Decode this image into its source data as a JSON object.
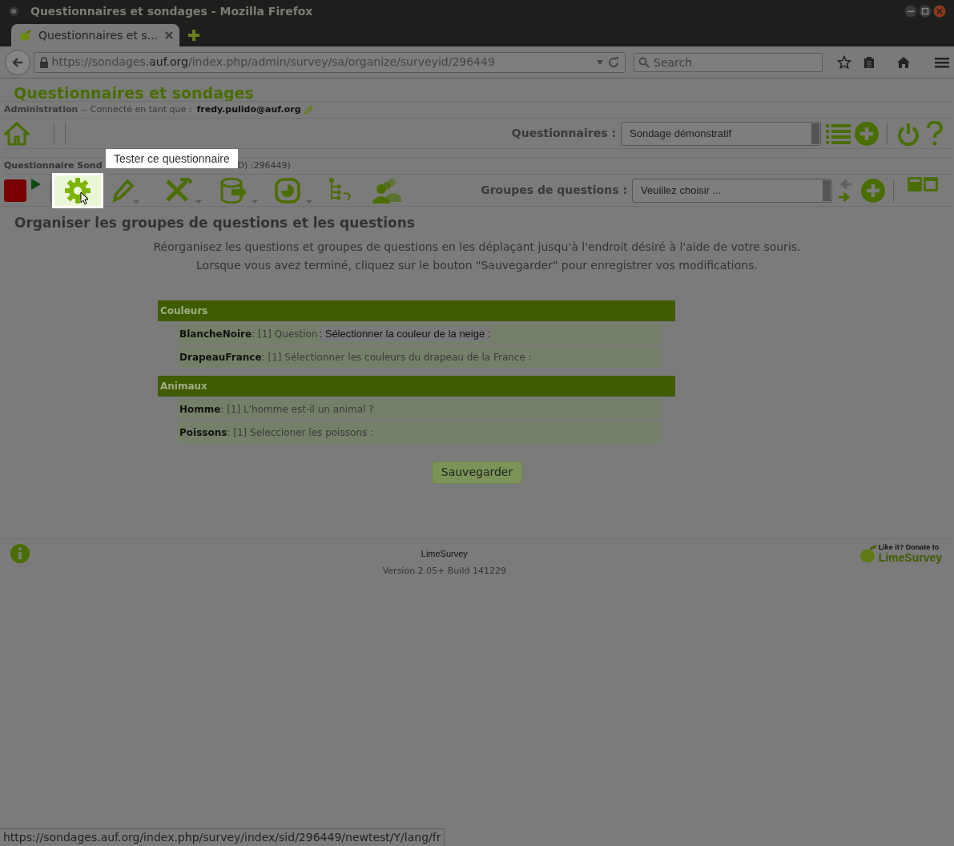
{
  "window": {
    "title": "Questionnaires et sondages - Mozilla Firefox"
  },
  "tabs": [
    {
      "label": "Questionnaires et s…",
      "selected": true
    }
  ],
  "address_bar": {
    "url_prefix": "https://sondages.",
    "url_domain": "auf.org",
    "url_path": "/index.php/admin/survey/sa/organize/surveyid/296449"
  },
  "search": {
    "placeholder": "Search"
  },
  "page": {
    "site_title": "Questionnaires et sondages",
    "admin_label": "Administration",
    "admin_text": "-- Connecté en tant que :",
    "user": "fredy.pulido@auf.org",
    "surveys_label": "Questionnaires :",
    "survey_select": "Sondage démonstratif",
    "survey_bar": [
      "Questionnaire Sond",
      "D) :296449)"
    ],
    "tooltip": "Tester ce questionnaire",
    "groups_label": "Groupes de questions :",
    "group_select": "Veuillez choisir ...",
    "heading": "Organiser les groupes de questions et les questions",
    "instructions": [
      "Réorganisez les questions et groupes de questions en les déplaçant jusqu'à l'endroit désiré à l'aide de votre souris.",
      "Lorsque vous avez terminé, cliquez sur le bouton \"Sauvegarder\" pour enregistrer vos modifications."
    ],
    "groups": [
      {
        "name": "Couleurs",
        "questions": [
          {
            "text": "**BlancheNoire**: [1] Question",
            "extra": ": Sélectionner la couleur de la neige :"
          },
          {
            "text": "**DrapeauFrance**: [1] Sélectionner les couleurs du drapeau de la France :"
          }
        ]
      },
      {
        "name": "Animaux",
        "questions": [
          {
            "text": "**Homme**: [1] L'homme est-il un animal ?"
          },
          {
            "text": "**Poissons**: [1] Seleccioner les poissons :"
          }
        ]
      }
    ],
    "save_button": "Sauvegarder"
  },
  "footer": {
    "name": "LimeSurvey",
    "version": "Version 2.05+ Build 141229",
    "donate_top": "Like it? Donate to",
    "donate_brand": "LimeSurvey"
  },
  "status_bar": "https://sondages.auf.org/index.php/survey/index/sid/296449/newtest/Y/lang/fr"
}
